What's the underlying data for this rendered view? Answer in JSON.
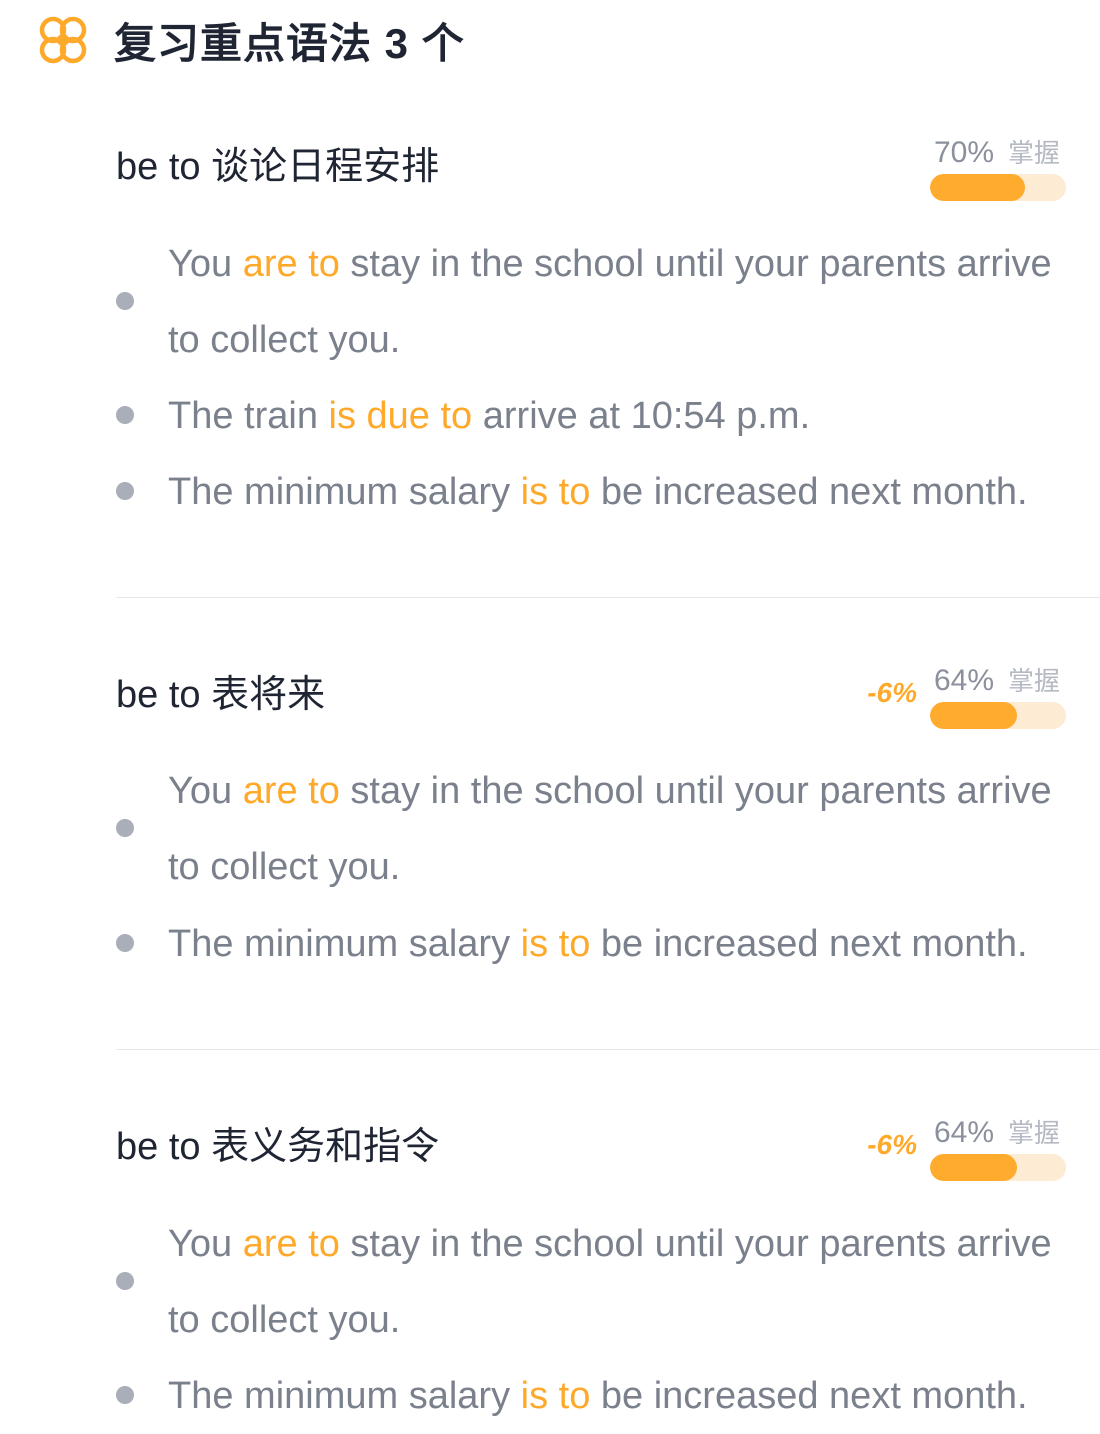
{
  "header": {
    "icon": "flower-knot-icon",
    "title": "复习重点语法 3 个",
    "accent_color": "#ffa92a"
  },
  "grammar_points": [
    {
      "title": "be to 谈论日程安排",
      "delta": "",
      "mastery_percent": "70%",
      "mastery_label": "掌握",
      "mastery_fraction": 0.7,
      "sentences": [
        {
          "before": "You ",
          "highlight": "are to",
          "after": " stay in the school until your parents arrive to collect you."
        },
        {
          "before": "The train ",
          "highlight": "is due to",
          "after": " arrive at 10:54 p.m."
        },
        {
          "before": "The minimum salary ",
          "highlight": "is to",
          "after": " be increased next month."
        }
      ]
    },
    {
      "title": "be to 表将来",
      "delta": "-6%",
      "mastery_percent": "64%",
      "mastery_label": "掌握",
      "mastery_fraction": 0.64,
      "sentences": [
        {
          "before": "You ",
          "highlight": "are to",
          "after": " stay in the school until your parents arrive to collect you."
        },
        {
          "before": "The minimum salary ",
          "highlight": "is to",
          "after": " be increased next month."
        }
      ]
    },
    {
      "title": "be to 表义务和指令",
      "delta": "-6%",
      "mastery_percent": "64%",
      "mastery_label": "掌握",
      "mastery_fraction": 0.64,
      "sentences": [
        {
          "before": "You ",
          "highlight": "are to",
          "after": " stay in the school until your parents arrive to collect you."
        },
        {
          "before": "The minimum salary ",
          "highlight": "is to",
          "after": " be increased next month."
        }
      ]
    }
  ]
}
